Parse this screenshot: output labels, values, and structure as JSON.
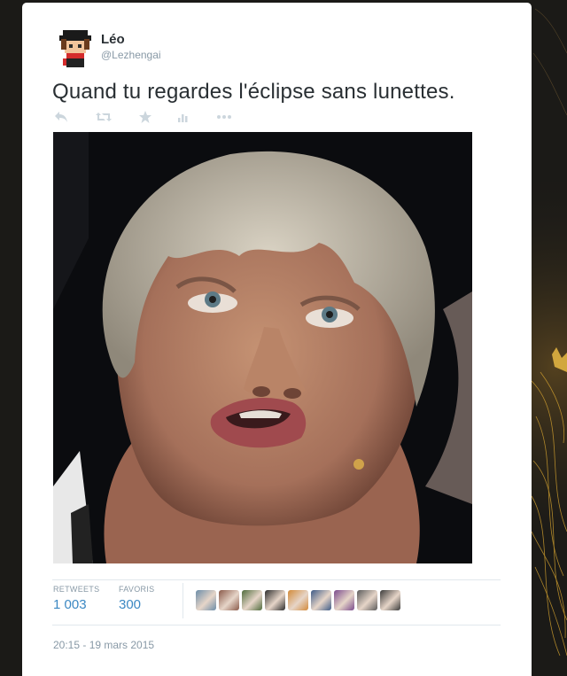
{
  "tweet": {
    "author_name": "Léo",
    "author_handle": "@Lezhengai",
    "text": "Quand tu regardes l'éclipse sans lunettes.",
    "timestamp": "20:15 - 19 mars 2015"
  },
  "actions": [
    {
      "name": "reply-icon"
    },
    {
      "name": "retweet-icon"
    },
    {
      "name": "favorite-icon"
    },
    {
      "name": "analytics-icon"
    },
    {
      "name": "more-icon"
    }
  ],
  "stats": {
    "retweets_label": "RETWEETS",
    "retweets_value": "1 003",
    "favorites_label": "FAVORIS",
    "favorites_value": "300"
  },
  "colors": {
    "link": "#3b88c3",
    "muted": "#8899a6",
    "text": "#292f33",
    "background": "#1b1a17",
    "accent_gold": "#c99a2e"
  },
  "favoriters": [
    {
      "name": "favoriter-avatar-1",
      "tone": "#6b8ca8"
    },
    {
      "name": "favoriter-avatar-2",
      "tone": "#8a5a4a"
    },
    {
      "name": "favoriter-avatar-3",
      "tone": "#4f6b3c"
    },
    {
      "name": "favoriter-avatar-4",
      "tone": "#2c2c2c"
    },
    {
      "name": "favoriter-avatar-5",
      "tone": "#d28a3a"
    },
    {
      "name": "favoriter-avatar-6",
      "tone": "#3d5a86"
    },
    {
      "name": "favoriter-avatar-7",
      "tone": "#7a4a8c"
    },
    {
      "name": "favoriter-avatar-8",
      "tone": "#5a5a5a"
    },
    {
      "name": "favoriter-avatar-9",
      "tone": "#3a3a3a"
    }
  ]
}
